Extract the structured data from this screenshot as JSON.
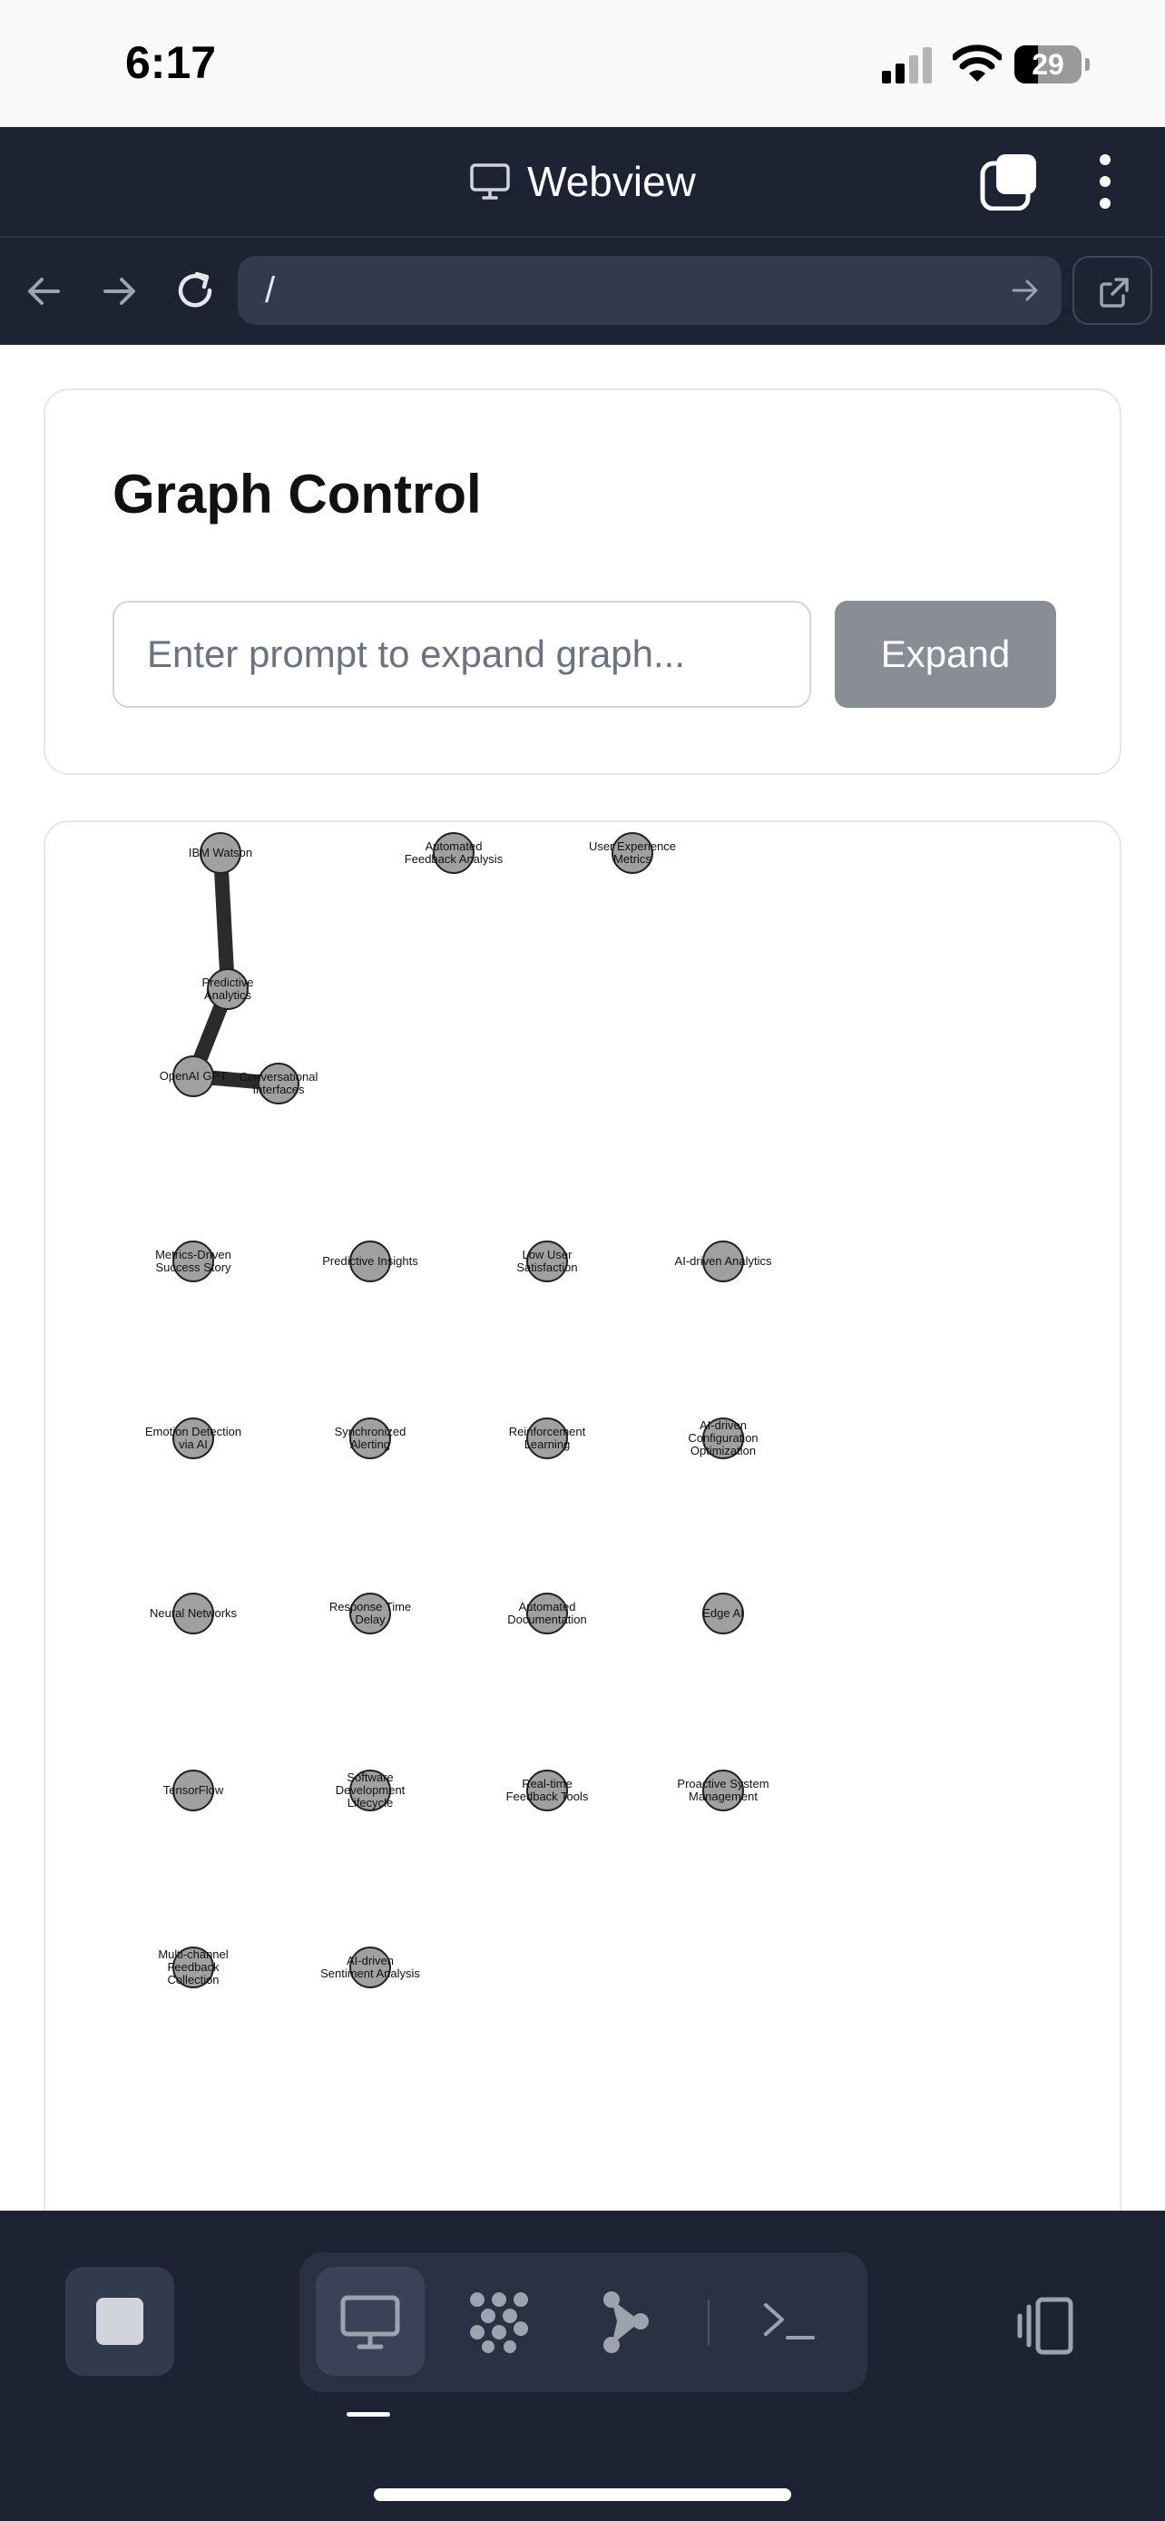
{
  "status_bar": {
    "time": "6:17",
    "battery": "29"
  },
  "title_bar": {
    "title": "Webview",
    "icons": [
      "monitor-icon",
      "tabs-icon",
      "more-vertical-icon"
    ]
  },
  "url_bar": {
    "url": "/",
    "icons": [
      "arrow-left-icon",
      "arrow-right-icon",
      "reload-icon",
      "go-arrow-icon",
      "external-link-icon"
    ]
  },
  "graph_control": {
    "title": "Graph Control",
    "prompt_placeholder": "Enter prompt to expand graph...",
    "expand_label": "Expand"
  },
  "graph": {
    "nodes": [
      {
        "id": "ibm",
        "lines": [
          "IBM Watson"
        ]
      },
      {
        "id": "afa",
        "lines": [
          "Automated",
          "Feedback Analysis"
        ]
      },
      {
        "id": "uxm",
        "lines": [
          "User Experience",
          "Metrics"
        ]
      },
      {
        "id": "pa",
        "lines": [
          "Predictive",
          "Analytics"
        ]
      },
      {
        "id": "gpt",
        "lines": [
          "OpenAI GPT"
        ]
      },
      {
        "id": "ci",
        "lines": [
          "Conversational",
          "Interfaces"
        ]
      },
      {
        "id": "mdss",
        "lines": [
          "Metrics-Driven",
          "Success Story"
        ]
      },
      {
        "id": "pi",
        "lines": [
          "Predictive Insights"
        ]
      },
      {
        "id": "lus",
        "lines": [
          "Low User",
          "Satisfaction"
        ]
      },
      {
        "id": "aida",
        "lines": [
          "AI-driven Analytics"
        ]
      },
      {
        "id": "ed",
        "lines": [
          "Emotion Detection",
          "via AI"
        ]
      },
      {
        "id": "sa",
        "lines": [
          "Synchronized",
          "Alerting"
        ]
      },
      {
        "id": "rl",
        "lines": [
          "Reinforcement",
          "Learning"
        ]
      },
      {
        "id": "aco",
        "lines": [
          "AI-driven",
          "Configuration",
          "Optimization"
        ]
      },
      {
        "id": "nn",
        "lines": [
          "Neural Networks"
        ]
      },
      {
        "id": "rtd",
        "lines": [
          "Response Time",
          "Delay"
        ]
      },
      {
        "id": "ad",
        "lines": [
          "Automated",
          "Documentation"
        ]
      },
      {
        "id": "edge",
        "lines": [
          "Edge AI"
        ]
      },
      {
        "id": "tf",
        "lines": [
          "TensorFlow"
        ]
      },
      {
        "id": "sdl",
        "lines": [
          "Software",
          "Development",
          "Lifecycle"
        ]
      },
      {
        "id": "rtft",
        "lines": [
          "Real-time",
          "Feedback Tools"
        ]
      },
      {
        "id": "psm",
        "lines": [
          "Proactive System",
          "Management"
        ]
      },
      {
        "id": "mcfc",
        "lines": [
          "Multi-channel",
          "Feedback",
          "Collection"
        ]
      },
      {
        "id": "aisa",
        "lines": [
          "AI-driven",
          "Sentiment Analysis"
        ]
      }
    ],
    "edges": [
      {
        "from": "ibm",
        "to": "pa"
      },
      {
        "from": "pa",
        "to": "gpt"
      },
      {
        "from": "gpt",
        "to": "ci"
      }
    ],
    "colors": {
      "node_fill": "#a0a0a0",
      "node_stroke": "#222222",
      "edge": "#2b2b2b"
    }
  },
  "bottom_bar": {
    "icons": [
      "stop-icon",
      "monitor-icon",
      "apps-icon",
      "flow-icon",
      "terminal-icon",
      "device-toggle-icon"
    ],
    "active_mode": "monitor"
  }
}
